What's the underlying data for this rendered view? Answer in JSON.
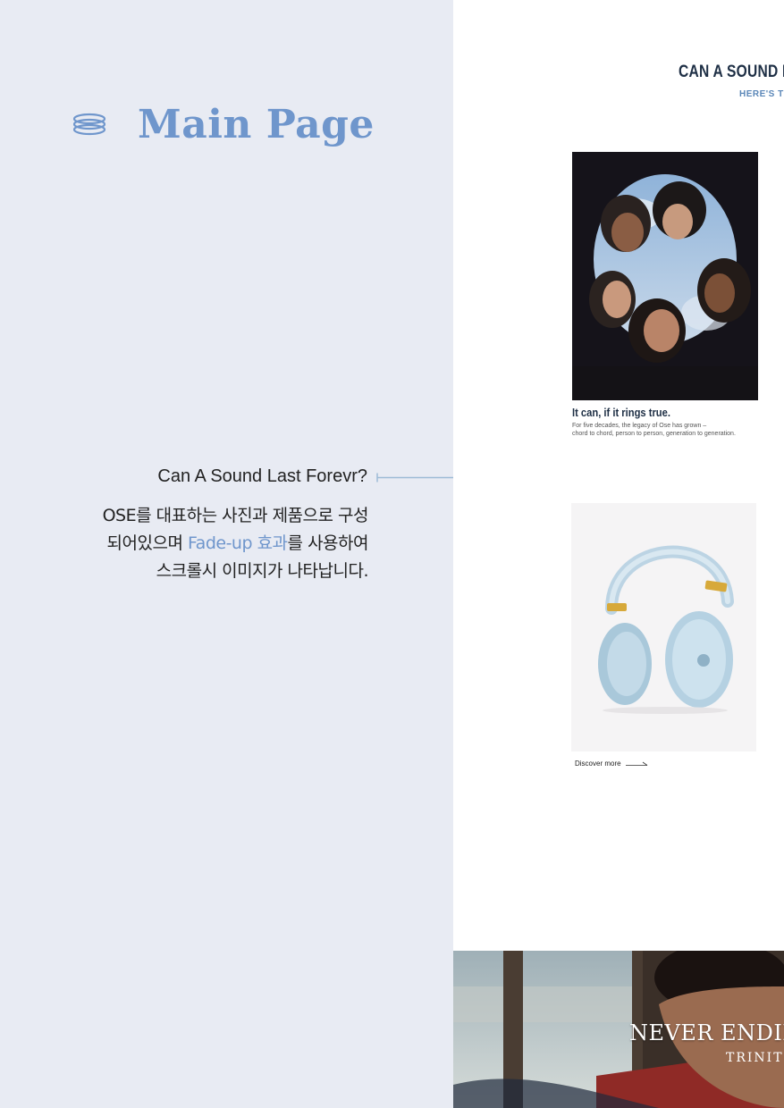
{
  "header": {
    "icon": "stack-icon",
    "title": "Main Page"
  },
  "annotation": {
    "heading": "Can A Sound Last Forevr?",
    "body_line1": "OSE를 대표하는 사진과 제품으로 구성",
    "body_line2_pre": "되어있으며 ",
    "body_line2_accent": "Fade-up 효과",
    "body_line2_post": "를 사용하여",
    "body_line3": "스크롤시 이미지가 나타납니다."
  },
  "preview": {
    "heading": "CAN A SOUND I",
    "subheading": "HERE'S TH",
    "photo_card": {
      "image": "group-of-young-people-looking-down-photo",
      "caption": "It can, if it rings true.",
      "desc_line1": "For five decades, the legacy of Ose has grown –",
      "desc_line2": "chord to chord, person to person, generation to generation."
    },
    "product_card": {
      "image": "light-blue-headphones-photo",
      "link_label": "Discover more"
    },
    "banner": {
      "image": "man-on-bus-photo",
      "title": "NEVER ENDIN",
      "subtitle": "TRINIT"
    }
  },
  "colors": {
    "left_bg": "#e8ebf3",
    "accent": "#6f96cc",
    "navy": "#1e2f45",
    "line": "#9dbbd6"
  }
}
